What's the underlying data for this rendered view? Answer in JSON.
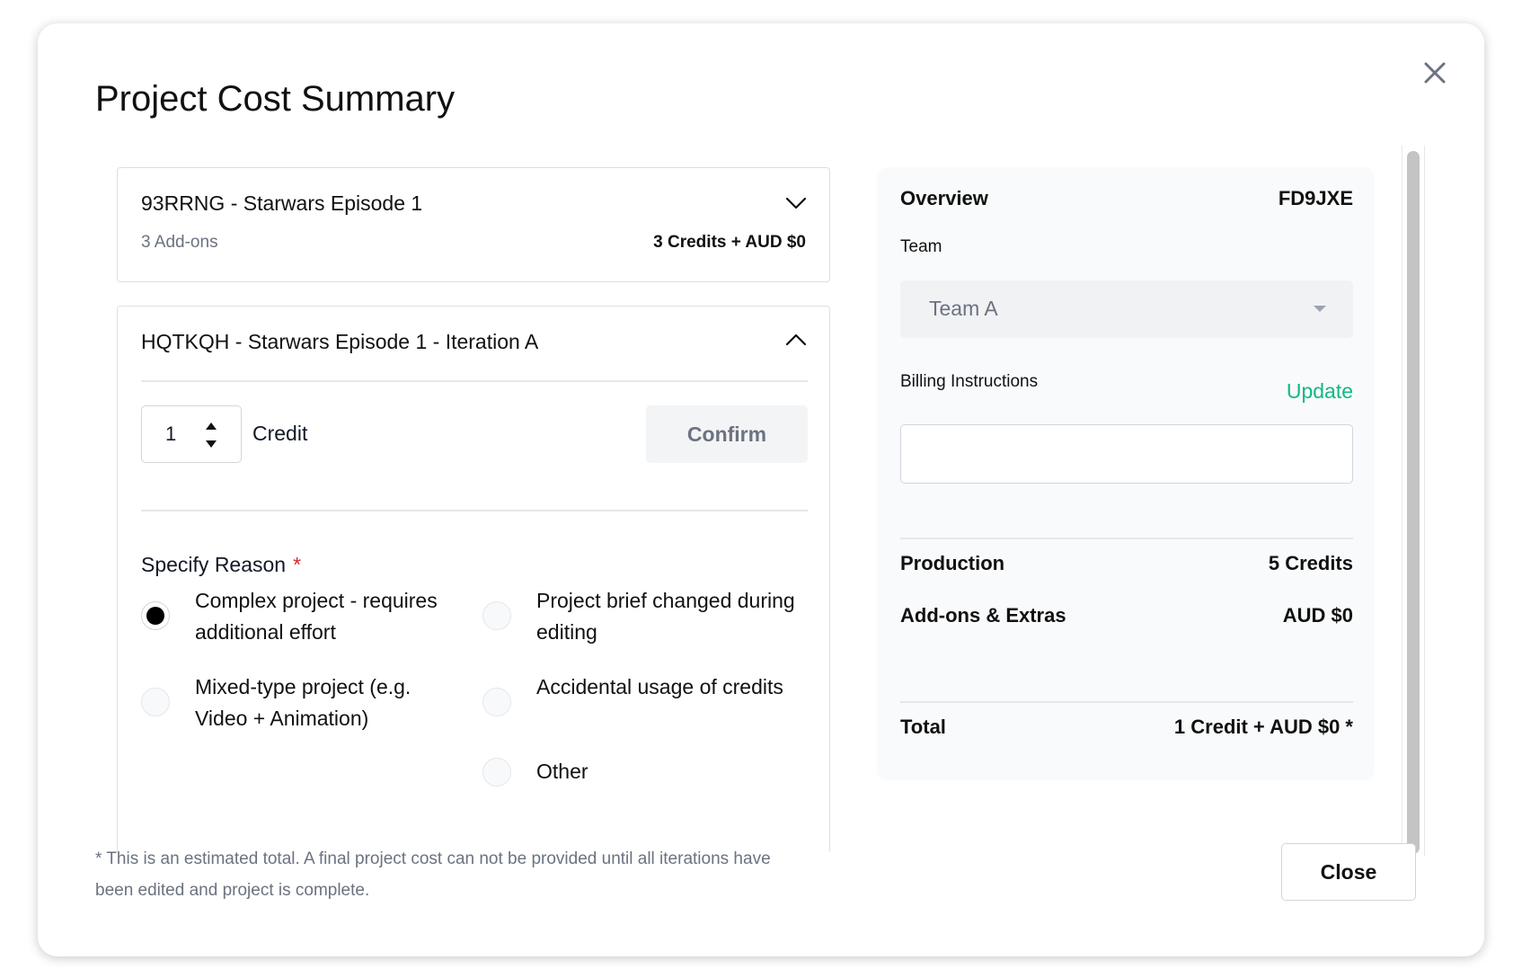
{
  "modal": {
    "title": "Project Cost Summary",
    "footnote": "* This is an estimated total. A final project cost can not be provided until all iterations have been edited and project is complete.",
    "close_label": "Close"
  },
  "projects": [
    {
      "title": "93RRNG - Starwars Episode 1",
      "addons": "3 Add-ons",
      "cost": "3 Credits + AUD $0",
      "expanded": false
    },
    {
      "title": "HQTKQH - Starwars Episode 1 - Iteration A",
      "expanded": true,
      "credit_value": "1",
      "credit_label": "Credit",
      "confirm_label": "Confirm",
      "reason_label": "Specify Reason",
      "required_mark": "*",
      "reasons": [
        {
          "label": "Complex project - requires additional effort",
          "checked": true
        },
        {
          "label": "Project brief changed during editing",
          "checked": false
        },
        {
          "label": "Mixed-type project (e.g. Video + Animation)",
          "checked": false
        },
        {
          "label": "Accidental usage of credits",
          "checked": false
        },
        {
          "label": "Other",
          "checked": false
        }
      ]
    }
  ],
  "overview": {
    "heading": "Overview",
    "code": "FD9JXE",
    "team_label": "Team",
    "team_value": "Team A",
    "billing_label": "Billing Instructions",
    "update_label": "Update",
    "billing_value": "",
    "production_label": "Production",
    "production_value": "5 Credits",
    "addons_label": "Add-ons & Extras",
    "addons_value": "AUD $0",
    "total_label": "Total",
    "total_value": "1 Credit + AUD $0 *"
  },
  "colors": {
    "accent": "#10b981",
    "required": "#dc2626"
  }
}
